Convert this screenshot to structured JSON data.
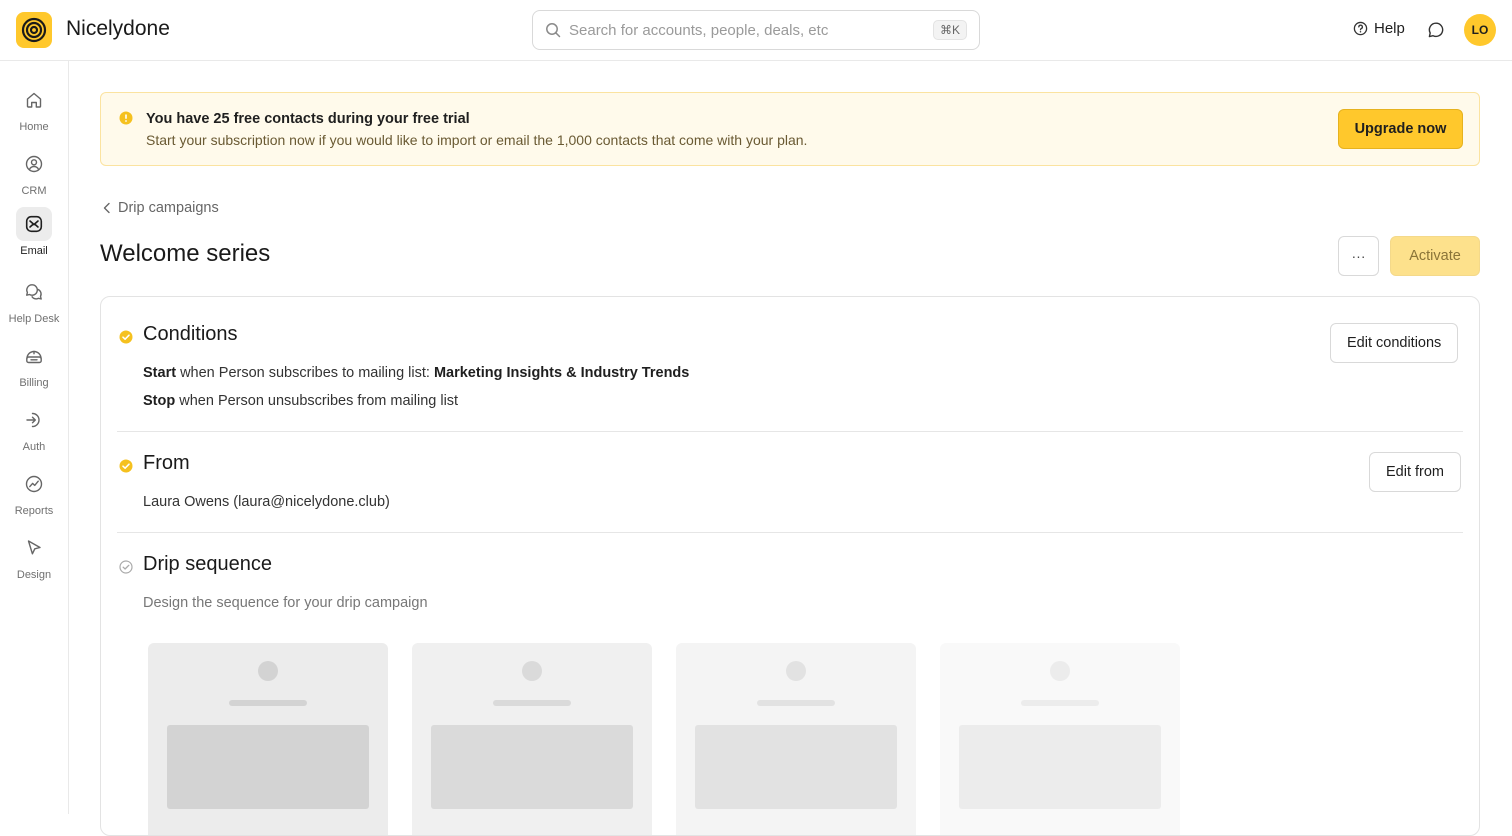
{
  "app": {
    "name": "Nicelydone"
  },
  "search": {
    "placeholder": "Search for accounts, people, deals, etc",
    "shortcut": "⌘K"
  },
  "header": {
    "help_label": "Help",
    "avatar_initials": "LO"
  },
  "sidebar": {
    "items": [
      {
        "label": "Home",
        "icon": "home-icon",
        "active": false
      },
      {
        "label": "CRM",
        "icon": "person-circle-icon",
        "active": false
      },
      {
        "label": "Email",
        "icon": "email-icon",
        "active": true
      },
      {
        "label": "Help Desk",
        "icon": "chat-bubbles-icon",
        "active": false
      },
      {
        "label": "Billing",
        "icon": "billing-icon",
        "active": false
      },
      {
        "label": "Auth",
        "icon": "login-icon",
        "active": false
      },
      {
        "label": "Reports",
        "icon": "chart-icon",
        "active": false
      },
      {
        "label": "Design",
        "icon": "cursor-icon",
        "active": false
      }
    ]
  },
  "banner": {
    "title": "You have 25 free contacts during your free trial",
    "text": "Start your subscription now if you would like to import or email the 1,000 contacts that come with your plan.",
    "button": "Upgrade now"
  },
  "breadcrumb": {
    "label": "Drip campaigns"
  },
  "page": {
    "title": "Welcome series",
    "more_label": "···",
    "activate_label": "Activate"
  },
  "conditions": {
    "title": "Conditions",
    "start_keyword": "Start",
    "start_text": " when Person subscribes to mailing list: ",
    "start_list": "Marketing Insights & Industry Trends",
    "stop_keyword": "Stop",
    "stop_text": " when Person unsubscribes from mailing list",
    "edit_label": "Edit conditions"
  },
  "from": {
    "title": "From",
    "value": "Laura Owens (laura@nicelydone.club)",
    "edit_label": "Edit from"
  },
  "drip": {
    "title": "Drip sequence",
    "subtitle": "Design the sequence for your drip campaign"
  },
  "colors": {
    "accent": "#ffc82c",
    "banner_bg": "#fffaeb",
    "activate_bg": "#fde18c"
  }
}
